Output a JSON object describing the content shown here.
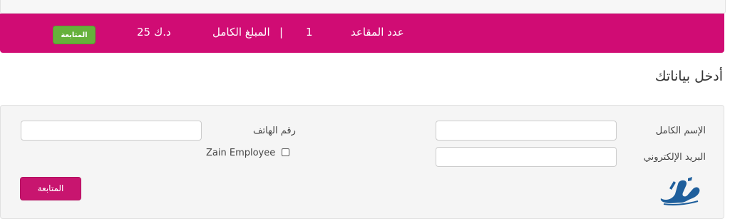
{
  "summary": {
    "seats_label": "عدد المقاعد",
    "seats_value": "1",
    "separator": "|",
    "total_label": "المبلغ الكامل",
    "total_value": "25 د.ك",
    "continue_label": "المتابعة"
  },
  "form": {
    "heading": "أدخل بياناتك",
    "full_name_label": "الإسم الكامل",
    "email_label": "البريد الإلكتروني",
    "phone_label": "رقم الهاتف",
    "zain_employee_label": "Zain Employee",
    "full_name_value": "",
    "email_value": "",
    "phone_value": "",
    "submit_label": "المتابعة"
  },
  "colors": {
    "brand_pink": "#d00c74",
    "continue_green": "#66b13b",
    "submit_pink": "#c8156f"
  },
  "icons": {
    "logo": "almrsal-logo"
  }
}
